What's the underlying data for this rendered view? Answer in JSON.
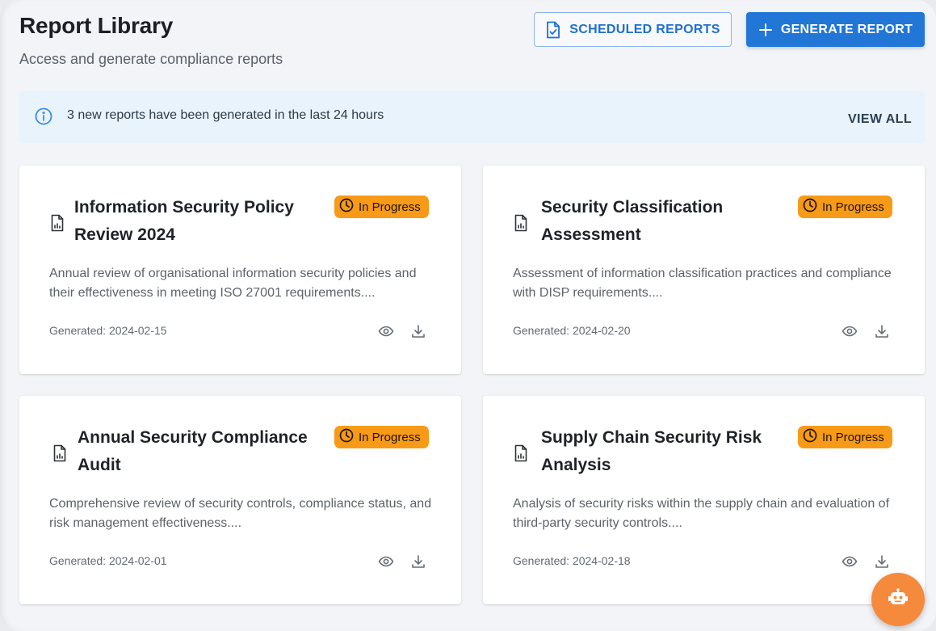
{
  "header": {
    "title": "Report Library",
    "subtitle": "Access and generate compliance reports",
    "scheduled_label": "SCHEDULED REPORTS",
    "generate_label": "GENERATE REPORT"
  },
  "alert": {
    "message": "3 new reports have been generated in the last 24 hours",
    "action_label": "VIEW ALL",
    "icon": "info-icon"
  },
  "reports": [
    {
      "title": "Information Security Policy Review 2024",
      "status": "In Progress",
      "description": "Annual review of organisational information security policies and their effectiveness in meeting ISO 27001 requirements....",
      "generated": "Generated: 2024-02-15"
    },
    {
      "title": "Security Classification Assessment",
      "status": "In Progress",
      "description": "Assessment of information classification practices and compliance with DISP requirements....",
      "generated": "Generated: 2024-02-20"
    },
    {
      "title": "Annual Security Compliance Audit",
      "status": "In Progress",
      "description": "Comprehensive review of security controls, compliance status, and risk management effectiveness....",
      "generated": "Generated: 2024-02-01"
    },
    {
      "title": "Supply Chain Security Risk Analysis",
      "status": "In Progress",
      "description": "Analysis of security risks within the supply chain and evaluation of third-party security controls....",
      "generated": "Generated: 2024-02-18"
    }
  ],
  "colors": {
    "primary": "#2176d6",
    "status_in_progress": "#f79a17",
    "assistant_fab": "#f58a3c"
  }
}
